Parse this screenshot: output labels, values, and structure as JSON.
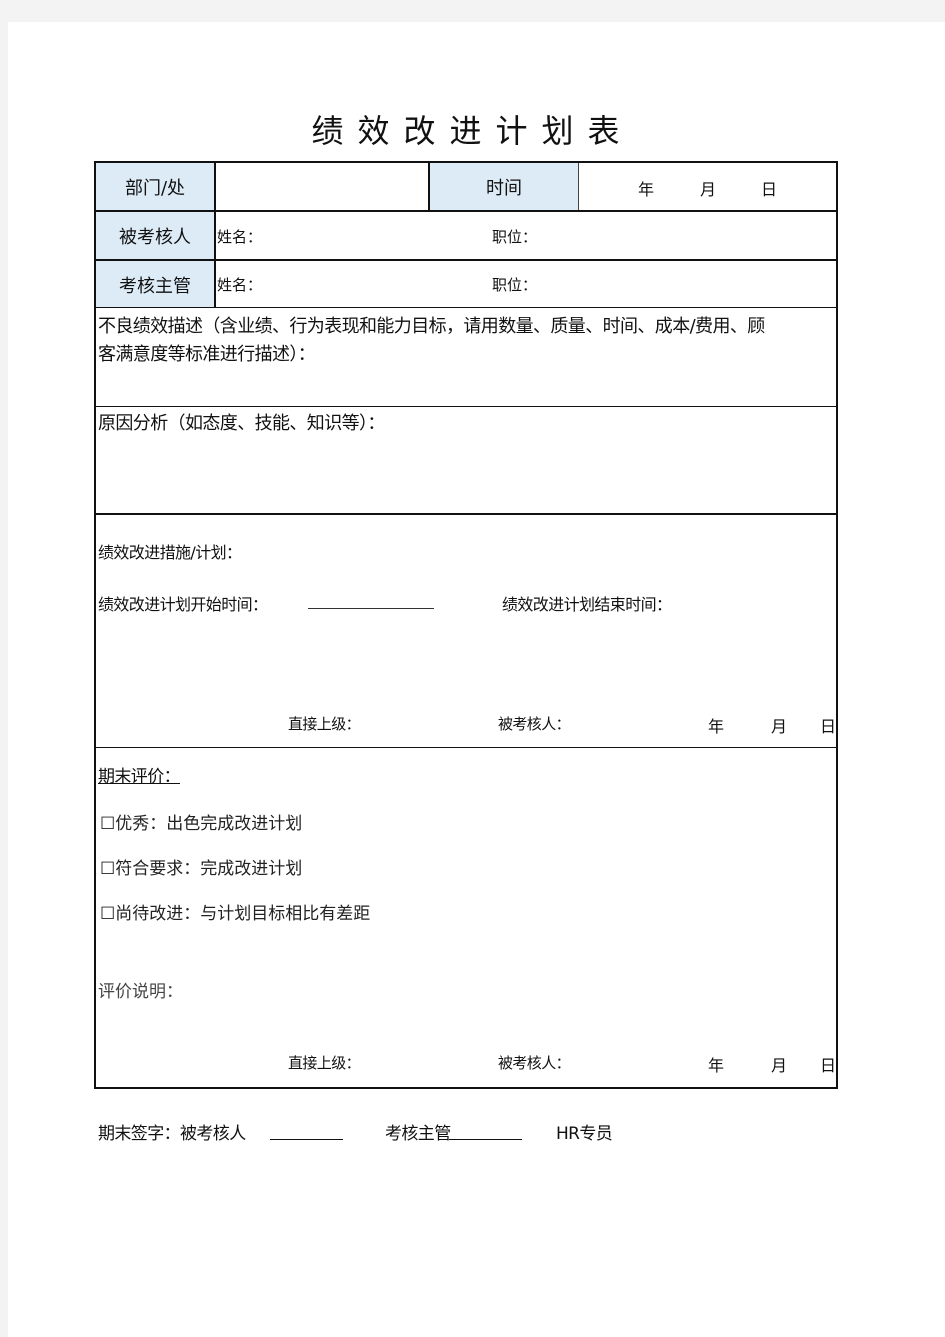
{
  "title": "绩效改进计划表",
  "header": {
    "dept_label": "部门/处",
    "dept_value": "",
    "time_label": "时间",
    "date": {
      "year": "年",
      "month": "月",
      "day": "日"
    }
  },
  "reviewee": {
    "label": "被考核人",
    "name_label": "姓名：",
    "position_label": "职位："
  },
  "supervisor": {
    "label": "考核主管",
    "name_label": "姓名：",
    "position_label": "职位："
  },
  "poor_performance": {
    "line1": "不良绩效描述（含业绩、行为表现和能力目标，请用数量、质量、时间、成本/费用、顾",
    "line2": "客满意度等标准进行描述）："
  },
  "cause_analysis": {
    "label": "原因分析（如态度、技能、知识等）："
  },
  "improvement": {
    "measures_label": "绩效改进措施/计划：",
    "start_label": "绩效改进计划开始时间：",
    "end_label": "绩效改进计划结束时间：",
    "sign": {
      "superior": "直接上级：",
      "reviewee": "被考核人：",
      "year": "年",
      "month": "月",
      "day": "日"
    }
  },
  "final_evaluation": {
    "heading": "期末评价：",
    "options": [
      {
        "label": "优秀：出色完成改进计划",
        "checked": false
      },
      {
        "label": "符合要求：完成改进计划",
        "checked": false
      },
      {
        "label": "尚待改进：与计划目标相比有差距",
        "checked": false
      }
    ],
    "comment_label": "评价说明：",
    "sign": {
      "superior": "直接上级：",
      "reviewee": "被考核人：",
      "year": "年",
      "month": "月",
      "day": "日"
    }
  },
  "footer": {
    "prefix": "期末签字：被考核人",
    "supervisor": "考核主管",
    "hr": "HR专员"
  },
  "colors": {
    "header_cell_bg": "#ddebf7",
    "border": "#111111",
    "page_bg": "#ffffff",
    "canvas_bg": "#f3f3f3"
  }
}
